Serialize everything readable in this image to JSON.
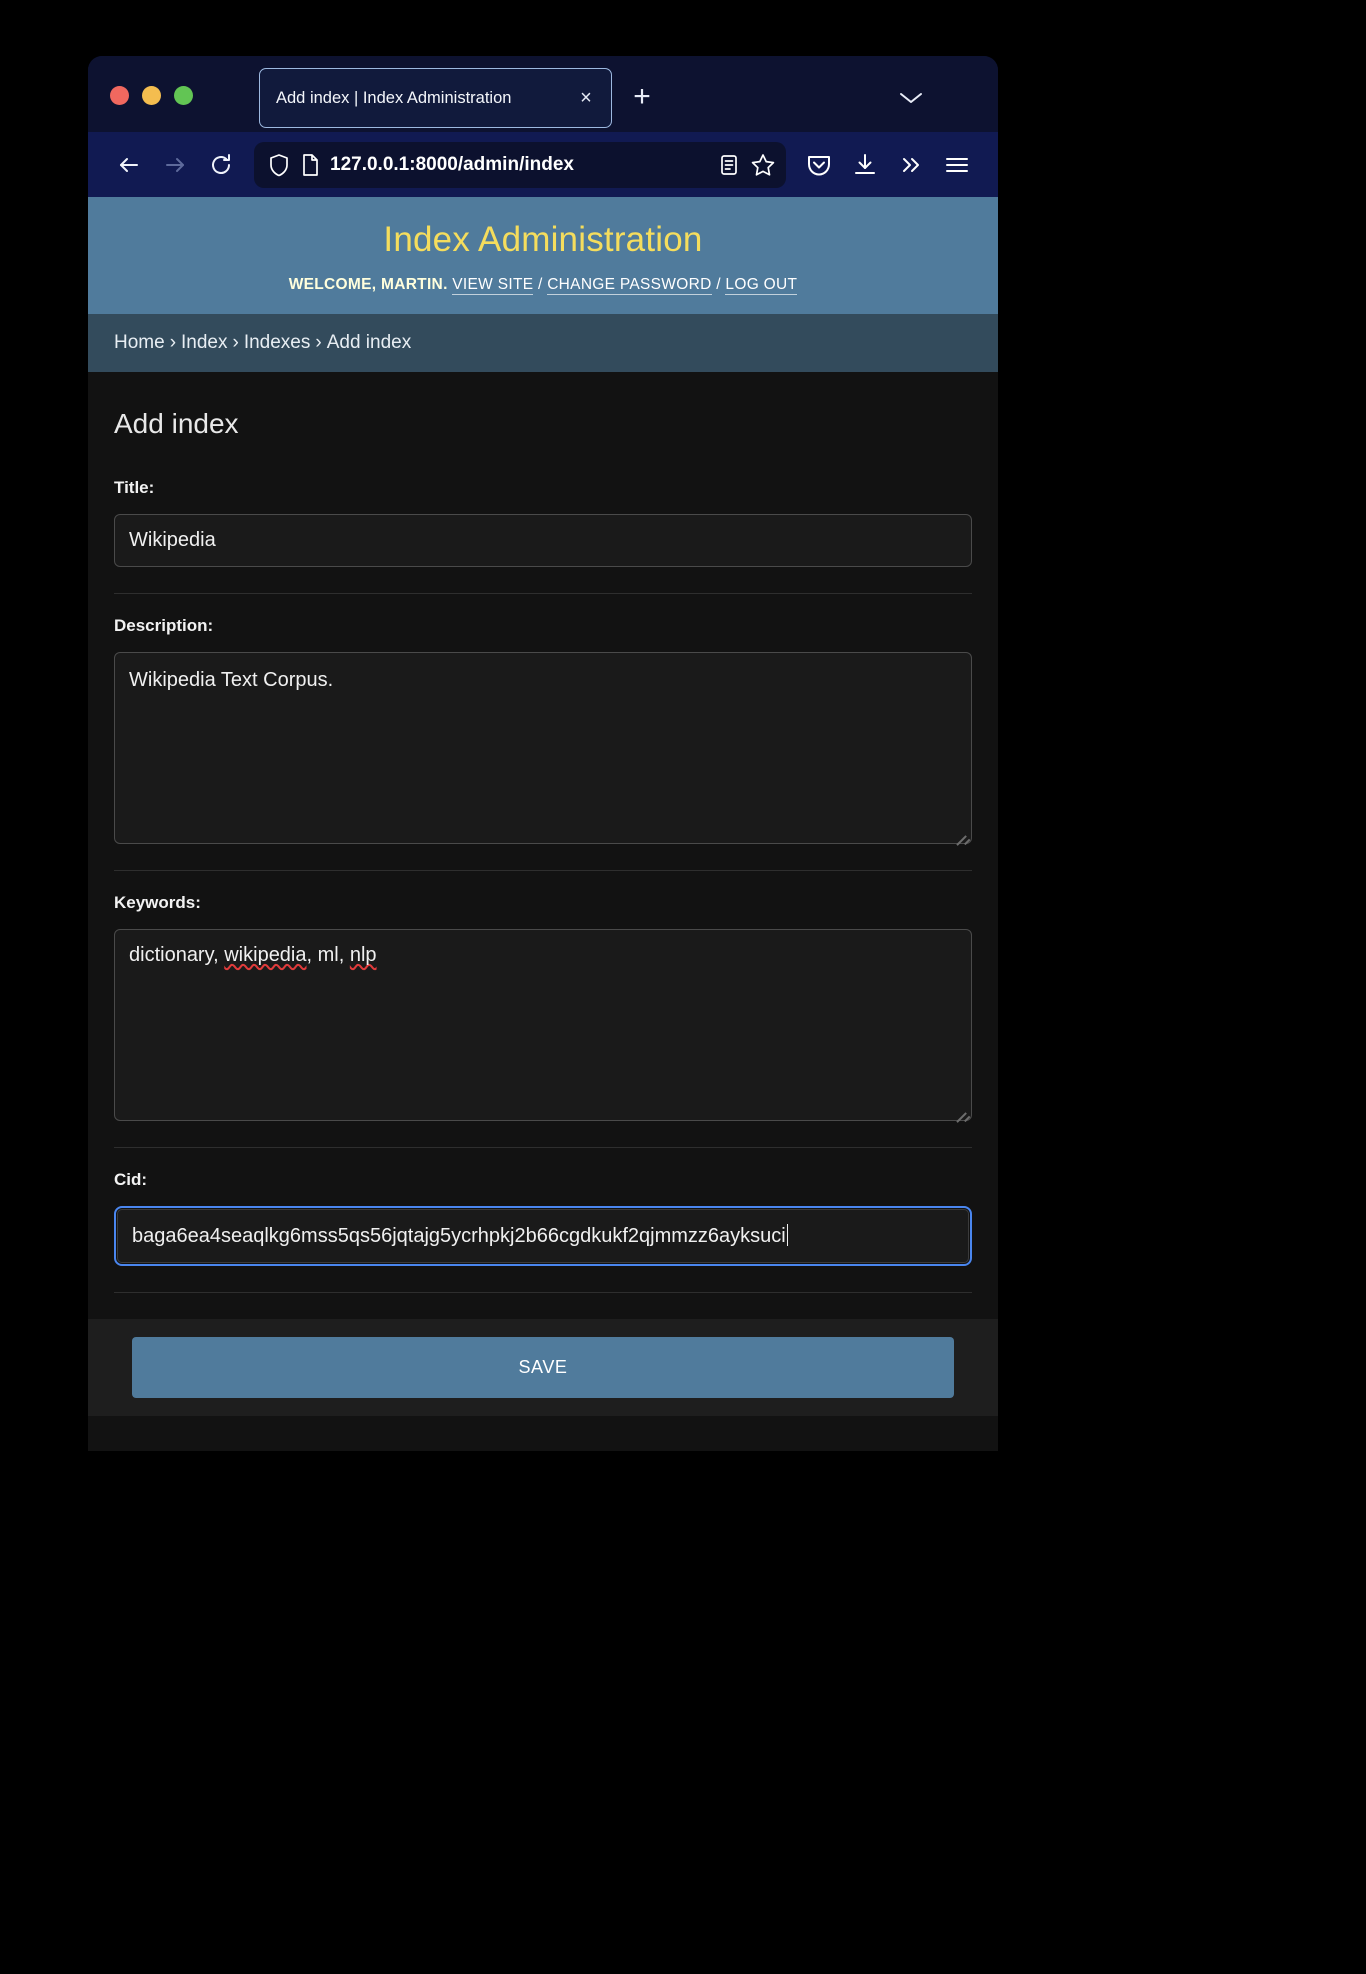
{
  "browser": {
    "window_controls": [
      "close",
      "minimize",
      "maximize"
    ],
    "tab": {
      "title": "Add index | Index Administration",
      "close_label": "×"
    },
    "new_tab_label": "+",
    "list_all_tabs_icon": "chevron-down-icon",
    "toolbar": {
      "back_icon": "back-arrow-icon",
      "forward_icon": "forward-arrow-icon",
      "reload_icon": "reload-icon",
      "shield_icon": "shield-icon",
      "page_icon": "page-icon",
      "url": "127.0.0.1:8000/admin/index",
      "reader_icon": "reader-view-icon",
      "bookmark_icon": "star-icon",
      "pocket_icon": "pocket-icon",
      "downloads_icon": "download-icon",
      "overflow_icon": "double-chevron-icon",
      "menu_icon": "hamburger-menu-icon"
    }
  },
  "site": {
    "title": "Index Administration",
    "welcome_prefix": "WELCOME,",
    "username": "MARTIN",
    "period": ".",
    "links": [
      {
        "label": "VIEW SITE"
      },
      {
        "label": "CHANGE PASSWORD"
      },
      {
        "label": "LOG OUT"
      }
    ],
    "separator": "/"
  },
  "breadcrumbs": {
    "separator": "›",
    "items": [
      {
        "label": "Home"
      },
      {
        "label": "Index"
      },
      {
        "label": "Indexes"
      },
      {
        "label": "Add index"
      }
    ]
  },
  "main": {
    "page_title": "Add index",
    "fields": [
      {
        "name": "title",
        "label": "Title:",
        "value": "Wikipedia",
        "type": "text"
      },
      {
        "name": "description",
        "label": "Description:",
        "value": "Wikipedia Text Corpus.",
        "type": "textarea"
      },
      {
        "name": "keywords",
        "label": "Keywords:",
        "value": "dictionary, wikipedia, ml, nlp",
        "type": "textarea",
        "misspelled": [
          "wikipedia",
          "nlp"
        ]
      },
      {
        "name": "cid",
        "label": "Cid:",
        "value": "baga6ea4seaqlkg6mss5qs56jqtajg5ycrhpkj2b66cgdkukf2qjmmzz6ayksuci",
        "type": "text",
        "focused": true
      }
    ],
    "save_label": "SAVE"
  },
  "keywords_parts": {
    "p1": "dictionary, ",
    "p2": "wikipedia",
    "p3": ", ml, ",
    "p4": "nlp"
  },
  "colors": {
    "header_bg": "#507b9c",
    "header_title": "#f5dd5d",
    "breadcrumb_bg": "#334b5c",
    "page_bg": "#121212",
    "focus_ring": "#4a86ef",
    "save_bg": "#507b9c"
  }
}
